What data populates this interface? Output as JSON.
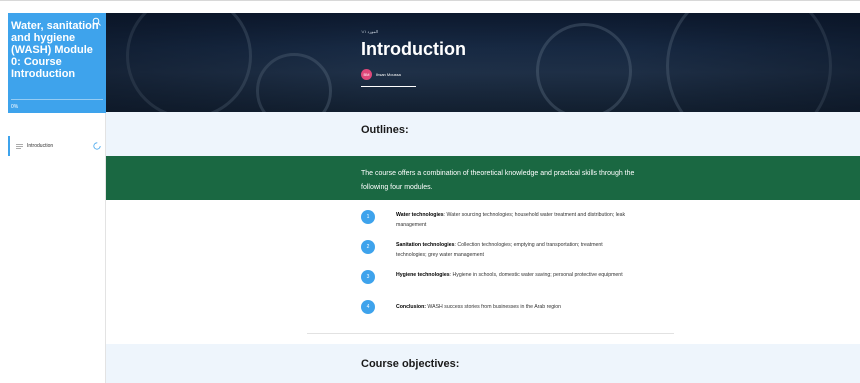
{
  "sidebar": {
    "course_title": "Water, sanitation and hygiene (WASH) Module 0: Course Introduction",
    "progress": "0%",
    "progress_fraction": 0,
    "lessons": [
      {
        "label": "Introduction",
        "status_icon": "progress-ring-icon"
      }
    ]
  },
  "banner": {
    "course_label": "المورد ١/١",
    "lesson_title": "Introduction",
    "author_initials": "BM",
    "author_name": "Ihsan Moussa"
  },
  "outlines": {
    "title": "Outlines:",
    "intro": "The course offers a combination of theoretical knowledge and practical skills through the following four modules.",
    "modules": [
      {
        "number": "1",
        "name": "Water technologies",
        "desc": ": Water sourcing technologies; household water treatment and distribution; leak management"
      },
      {
        "number": "2",
        "name": "Sanitation technologies",
        "desc": ": Collection technologies; emptying and transportation; treatment technologies; grey water management"
      },
      {
        "number": "3",
        "name": "Hygiene technologies",
        "desc": ": Hygiene in schools, domestic water saving; personal protective equipment"
      },
      {
        "number": "4",
        "name": "Conclusion:",
        "desc": " WASH success stories from businesses in the Arab region"
      }
    ]
  },
  "objectives": {
    "title": "Course objectives:"
  },
  "colors": {
    "accent": "#3ea3ec",
    "green": "#1a6842",
    "light": "#eef5fc"
  }
}
